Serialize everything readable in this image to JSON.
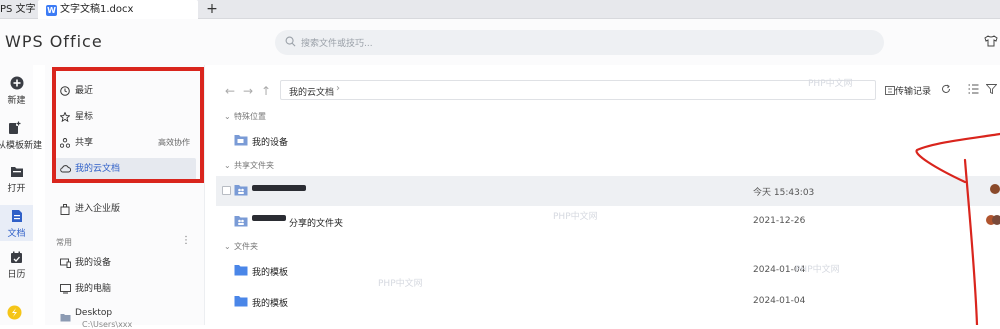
{
  "tabs": {
    "app_label": "PS 文字",
    "doc_label": "文字文稿1.docx",
    "add_label": "+"
  },
  "header": {
    "brand": "WPS Office",
    "search_placeholder": "搜索文件或技巧..."
  },
  "rail": {
    "items": [
      {
        "label": "新建",
        "icon": "plus-circle-icon"
      },
      {
        "label": "从模板新建",
        "icon": "template-icon"
      },
      {
        "label": "打开",
        "icon": "folder-open-icon"
      },
      {
        "label": "文档",
        "icon": "document-icon"
      },
      {
        "label": "日历",
        "icon": "calendar-icon"
      }
    ]
  },
  "nav": {
    "items": [
      {
        "label": "最近",
        "icon": "clock-icon"
      },
      {
        "label": "星标",
        "icon": "star-icon"
      },
      {
        "label": "共享",
        "icon": "share-icon",
        "right": "高效协作"
      },
      {
        "label": "我的云文档",
        "icon": "cloud-icon"
      }
    ],
    "enterprise": "进入企业版",
    "common_label": "常用",
    "common_items": [
      {
        "label": "我的设备",
        "icon": "device-icon"
      },
      {
        "label": "我的电脑",
        "icon": "computer-icon"
      },
      {
        "label": "Desktop",
        "sub": "C:\\Users\\xxx",
        "icon": "folder-icon"
      }
    ]
  },
  "toolbar": {
    "path": "我的云文档",
    "transfer": "传输记录"
  },
  "groups": {
    "special": "特殊位置",
    "shared": "共享文件夹",
    "folders": "文件夹"
  },
  "rows": [
    {
      "name": "我的设备",
      "date": ""
    },
    {
      "name": "",
      "date": "今天 15:43:03"
    },
    {
      "name": "分享的文件夹",
      "date": "2021-12-26"
    },
    {
      "name": "我的模板",
      "date": "2024-01-04"
    },
    {
      "name": "我的模板",
      "date": "2024-01-04"
    }
  ],
  "watermarks": [
    "PHP中文网",
    "PHP中文网",
    "PHP中文网",
    "PHP中文网"
  ],
  "colors": {
    "accent": "#3060c8",
    "annotation": "#d9251d",
    "folder": "#4a86e8"
  }
}
